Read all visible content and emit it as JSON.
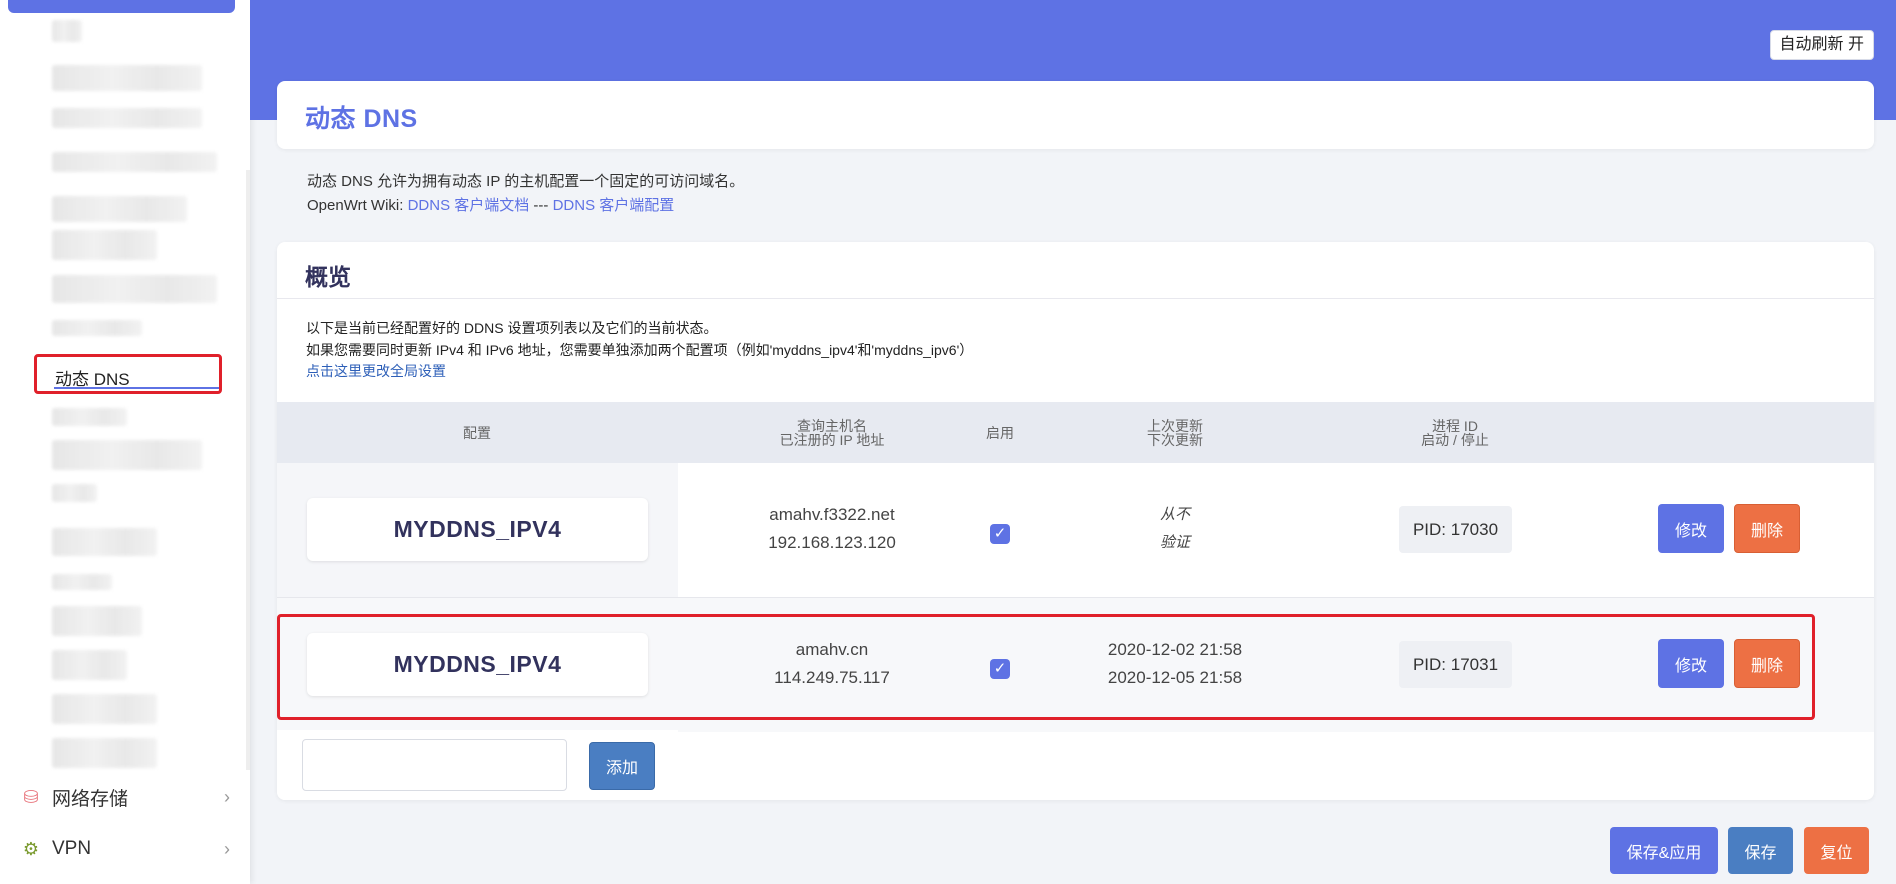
{
  "sidebar": {
    "active_item": "动态 DNS",
    "sections": [
      {
        "label": "网络存储",
        "icon": "database-icon"
      },
      {
        "label": "VPN",
        "icon": "globe-gear-icon"
      }
    ]
  },
  "header": {
    "auto_refresh": "自动刷新 开"
  },
  "page": {
    "title": "动态 DNS",
    "desc_line1": "动态 DNS 允许为拥有动态 IP 的主机配置一个固定的可访问域名。",
    "wiki_prefix": "OpenWrt Wiki: ",
    "wiki_link1": "DDNS 客户端文档",
    "wiki_sep": " --- ",
    "wiki_link2": "DDNS 客户端配置"
  },
  "overview": {
    "title": "概览",
    "line1": "以下是当前已经配置好的 DDNS 设置项列表以及它们的当前状态。",
    "line2": "如果您需要同时更新 IPv4 和 IPv6 地址，您需要单独添加两个配置项（例如'myddns_ipv4'和'myddns_ipv6'）",
    "global_link": "点击这里更改全局设置",
    "headers": {
      "config": "配置",
      "host_1": "查询主机名",
      "host_2": "已注册的 IP 地址",
      "enabled": "启用",
      "update_1": "上次更新",
      "update_2": "下次更新",
      "pid_1": "进程 ID",
      "pid_2": "启动 / 停止"
    },
    "rows": [
      {
        "name": "MYDDNS_IPV4",
        "host": "amahv.f3322.net",
        "ip": "192.168.123.120",
        "enabled": true,
        "last_update": "从不",
        "next_update": "验证",
        "pid": "PID: 17030",
        "edit": "修改",
        "delete": "删除"
      },
      {
        "name": "MYDDNS_IPV4",
        "host": "amahv.cn",
        "ip": "114.249.75.117",
        "enabled": true,
        "last_update": "2020-12-02 21:58",
        "next_update": "2020-12-05 21:58",
        "pid": "PID: 17031",
        "edit": "修改",
        "delete": "删除"
      }
    ],
    "add_input_value": "",
    "add_button": "添加"
  },
  "footer": {
    "save_apply": "保存&应用",
    "save": "保存",
    "reset": "复位"
  },
  "colors": {
    "accent": "#5e72e4",
    "danger": "#ed7044",
    "highlight": "#e0202a"
  }
}
